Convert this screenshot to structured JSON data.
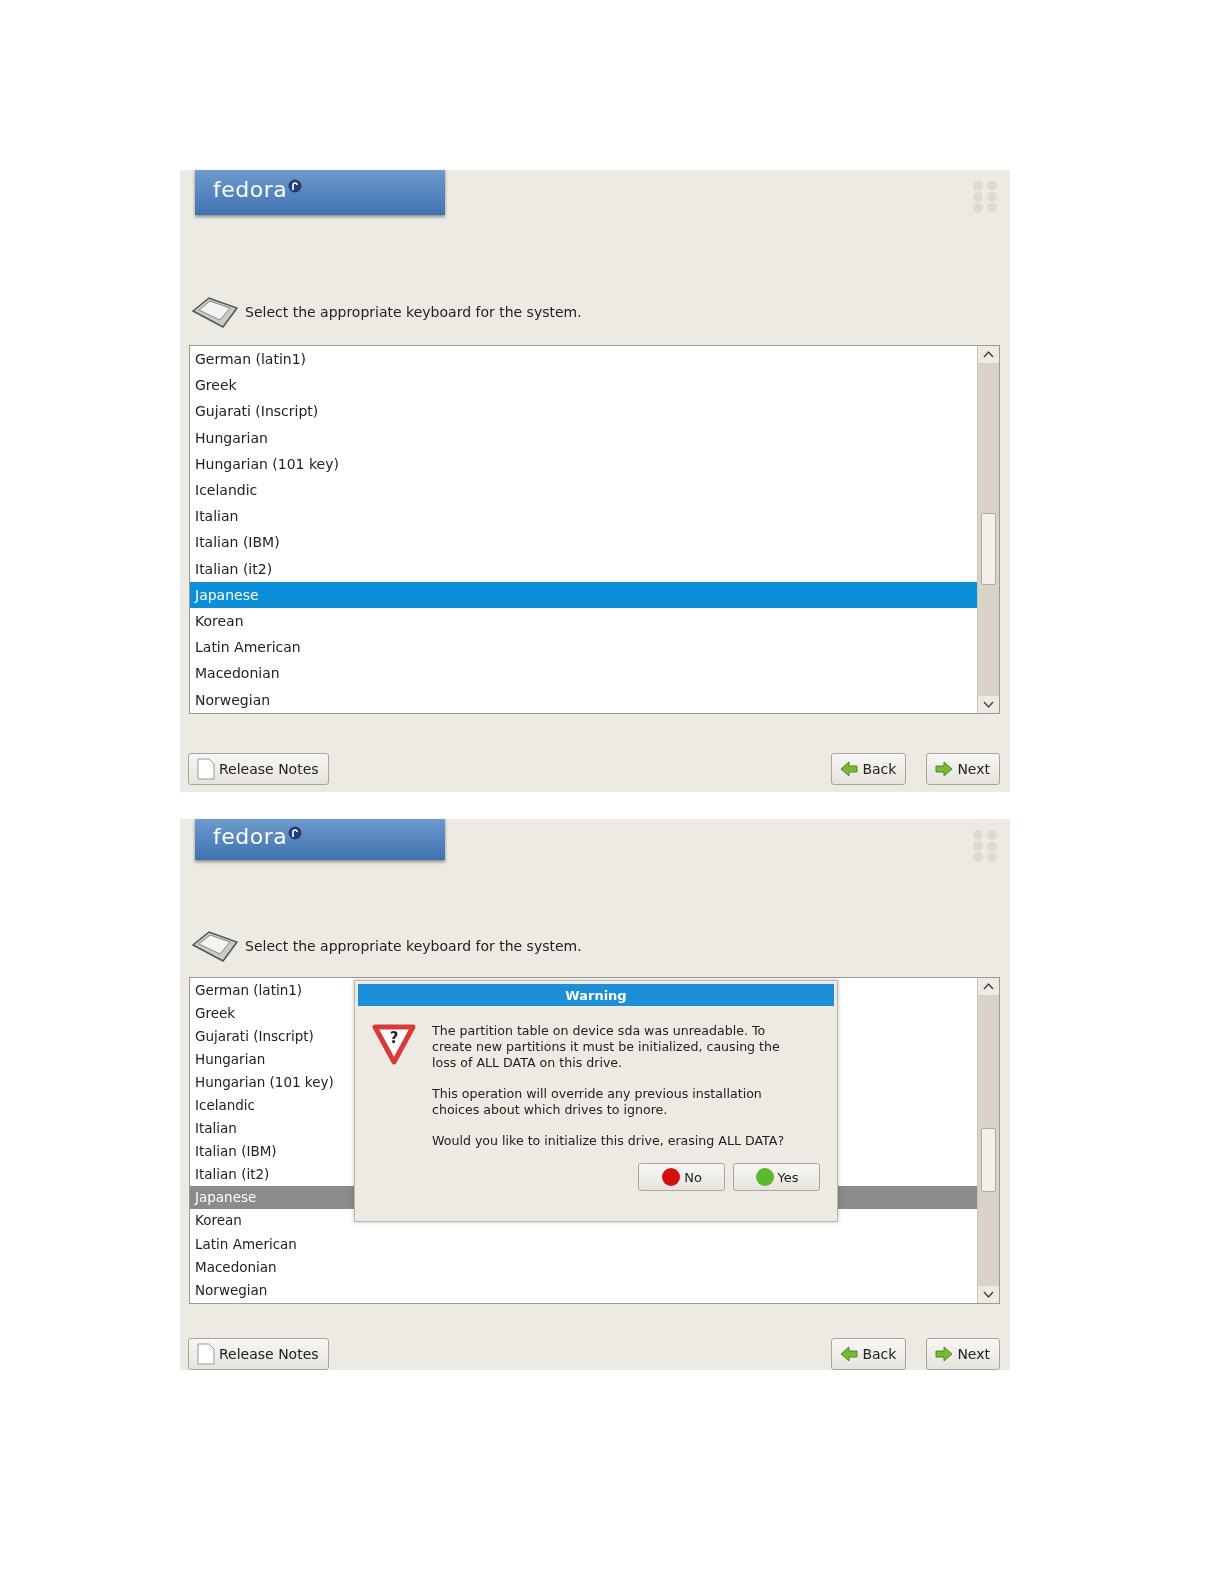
{
  "screens": [
    {
      "logo": "fedora",
      "prompt": "Select the appropriate keyboard for the system.",
      "list_focused": true,
      "keyboards": [
        {
          "label": "German (latin1)",
          "selected": false
        },
        {
          "label": "Greek",
          "selected": false
        },
        {
          "label": "Gujarati (Inscript)",
          "selected": false
        },
        {
          "label": "Hungarian",
          "selected": false
        },
        {
          "label": "Hungarian (101 key)",
          "selected": false
        },
        {
          "label": "Icelandic",
          "selected": false
        },
        {
          "label": "Italian",
          "selected": false
        },
        {
          "label": "Italian (IBM)",
          "selected": false
        },
        {
          "label": "Italian (it2)",
          "selected": false
        },
        {
          "label": "Japanese",
          "selected": true
        },
        {
          "label": "Korean",
          "selected": false
        },
        {
          "label": "Latin American",
          "selected": false
        },
        {
          "label": "Macedonian",
          "selected": false
        },
        {
          "label": "Norwegian",
          "selected": false
        }
      ],
      "buttons": [
        {
          "label": "Release Notes",
          "kind": "notes"
        },
        {
          "label": "Back",
          "kind": "back"
        },
        {
          "label": "Next",
          "kind": "next"
        }
      ]
    },
    {
      "logo": "fedora",
      "prompt": "Select the appropriate keyboard for the system.",
      "list_focused": false,
      "keyboards": [
        {
          "label": "German (latin1)",
          "selected": false
        },
        {
          "label": "Greek",
          "selected": false
        },
        {
          "label": "Gujarati (Inscript)",
          "selected": false
        },
        {
          "label": "Hungarian",
          "selected": false
        },
        {
          "label": "Hungarian (101 key)",
          "selected": false
        },
        {
          "label": "Icelandic",
          "selected": false
        },
        {
          "label": "Italian",
          "selected": false
        },
        {
          "label": "Italian (IBM)",
          "selected": false
        },
        {
          "label": "Italian (it2)",
          "selected": false
        },
        {
          "label": "Japanese",
          "selected": true
        },
        {
          "label": "Korean",
          "selected": false
        },
        {
          "label": "Latin American",
          "selected": false
        },
        {
          "label": "Macedonian",
          "selected": false
        },
        {
          "label": "Norwegian",
          "selected": false
        }
      ],
      "buttons": [
        {
          "label": "Release Notes",
          "kind": "notes"
        },
        {
          "label": "Back",
          "kind": "back"
        },
        {
          "label": "Next",
          "kind": "next"
        }
      ],
      "dialog": {
        "title": "Warning",
        "icon_glyph": "?",
        "paragraphs": [
          "The partition table on device sda was unreadable. To create new partitions it must be initialized, causing the loss of ALL DATA on this drive.",
          "This operation will override any previous installation choices about which drives to ignore.",
          "Would you like to initialize this drive, erasing ALL DATA?"
        ],
        "buttons": [
          {
            "label": "No",
            "kind": "no"
          },
          {
            "label": "Yes",
            "kind": "yes"
          }
        ]
      }
    }
  ]
}
